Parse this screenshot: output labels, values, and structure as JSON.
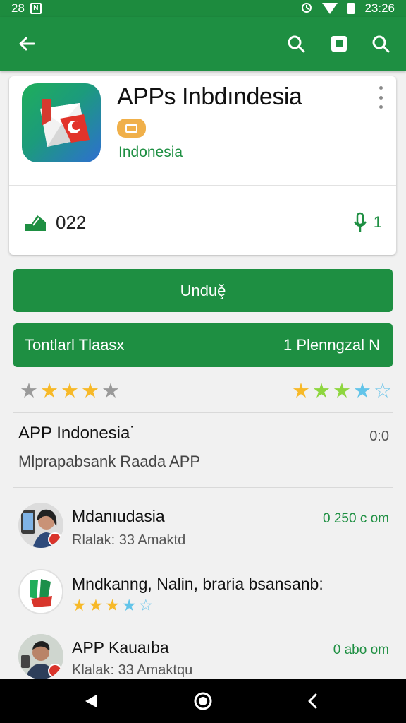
{
  "status_bar": {
    "left_text": "28",
    "badge_letter": "N",
    "time": "23:26"
  },
  "app_bar": {
    "back_icon": "arrow-back-icon",
    "search_icon": "search-icon",
    "cast_icon": "square-icon",
    "search2_icon": "search-icon"
  },
  "app": {
    "title": "APPs Inbdındesia",
    "developer": "Indonesia",
    "badge_icon": "editors-choice-icon",
    "downloads": "022",
    "stat_right": "1"
  },
  "buttons": {
    "install": "Unduḝ",
    "wide_left": "Tontlarl Tlaasx",
    "wide_right": "1 Plenngzal N"
  },
  "ratings": {
    "left_stars": [
      "gray",
      "gold",
      "gold",
      "gold",
      "gray"
    ],
    "right_stars": [
      "gold",
      "lime",
      "lime",
      "cyan",
      "outline"
    ]
  },
  "section": {
    "title": "APP Indonesia˙",
    "subtitle": "Mlprapabsank Raada APP",
    "meta": "0:0"
  },
  "reviews": [
    {
      "name": "Mdanıudasia",
      "subtitle": "Rlalak: 33 Amaktd",
      "meta": "0 250 c om"
    },
    {
      "name": "Mndkanng, Nalin, braria bsansanb:",
      "stars": [
        "gold",
        "gold",
        "gold",
        "cyan",
        "outline"
      ]
    },
    {
      "name": "APP Kauaıba",
      "subtitle": "Klalak: 33 Amaktqu",
      "meta": "0 abo om"
    }
  ],
  "colors": {
    "primary": "#1e8f42",
    "status": "#1d8b3e",
    "badge": "#f0b04a"
  }
}
